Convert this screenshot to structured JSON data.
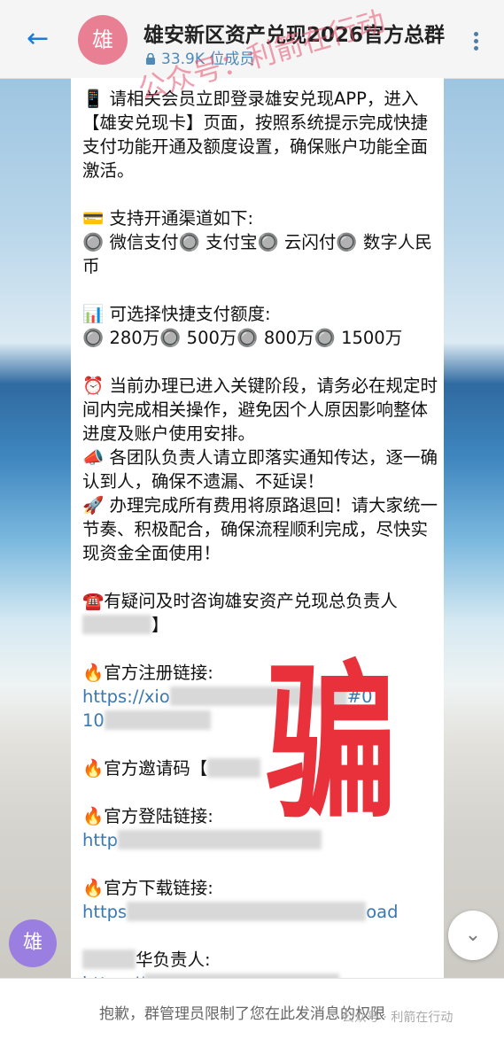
{
  "header": {
    "back_icon": "back-arrow-icon",
    "avatar_char": "雄",
    "title": "雄安新区资产兑现2026官方总群",
    "member_count": "33.9K 位成员",
    "more_icon": "more-vert-icon"
  },
  "message": {
    "p1": "📱 请相关会员立即登录雄安兑现APP，进入【雄安兑现卡】页面，按照系统提示完成快捷支付功能开通及额度设置，确保账户功能全面激活。",
    "p2_head": "💳 支持开通渠道如下:",
    "p2_items": "🔘 微信支付🔘 支付宝🔘 云闪付🔘 数字人民币",
    "p3_head": "📊 可选择快捷支付额度:",
    "p3_items": "🔘 280万🔘 500万🔘 800万🔘 1500万",
    "p4": "⏰ 当前办理已进入关键阶段，请务必在规定时间内完成相关操作，避免因个人原因影响整体进度及账户使用安排。",
    "p5": "📣 各团队负责人请立即落实通知传达，逐一确认到人，确保不遗漏、不延误！",
    "p6": "🚀 办理完成所有费用将原路退回！请大家统一节奏、积极配合，确保流程顺利完成，尽快实现资金全面使用！",
    "p7": "☎️有疑问及时咨询雄安资产兑现总负责人",
    "p7_tail": "】",
    "reg_label": "🔥官方注册链接:",
    "reg_link_start": "https://xio",
    "reg_link_mid": "#0",
    "reg_link_line2": "10",
    "invite_label": "🔥官方邀请码【",
    "login_label": "🔥官方登陆链接:",
    "login_link": "http",
    "download_label": "🔥官方下载链接:",
    "download_link_start": "https",
    "download_link_end": "oad",
    "owner_label": "华负责人:",
    "owner_link": "https://"
  },
  "overlay": {
    "scam_char": "骗",
    "watermark": "公众号：利箭在行动"
  },
  "bottom": {
    "avatar_char": "雄",
    "scroll_down_icon": "chevron-down-icon",
    "restriction_text": "抱歉，群管理员限制了您在此发消息的权限",
    "credit": "公众号 · 利箭在行动"
  }
}
